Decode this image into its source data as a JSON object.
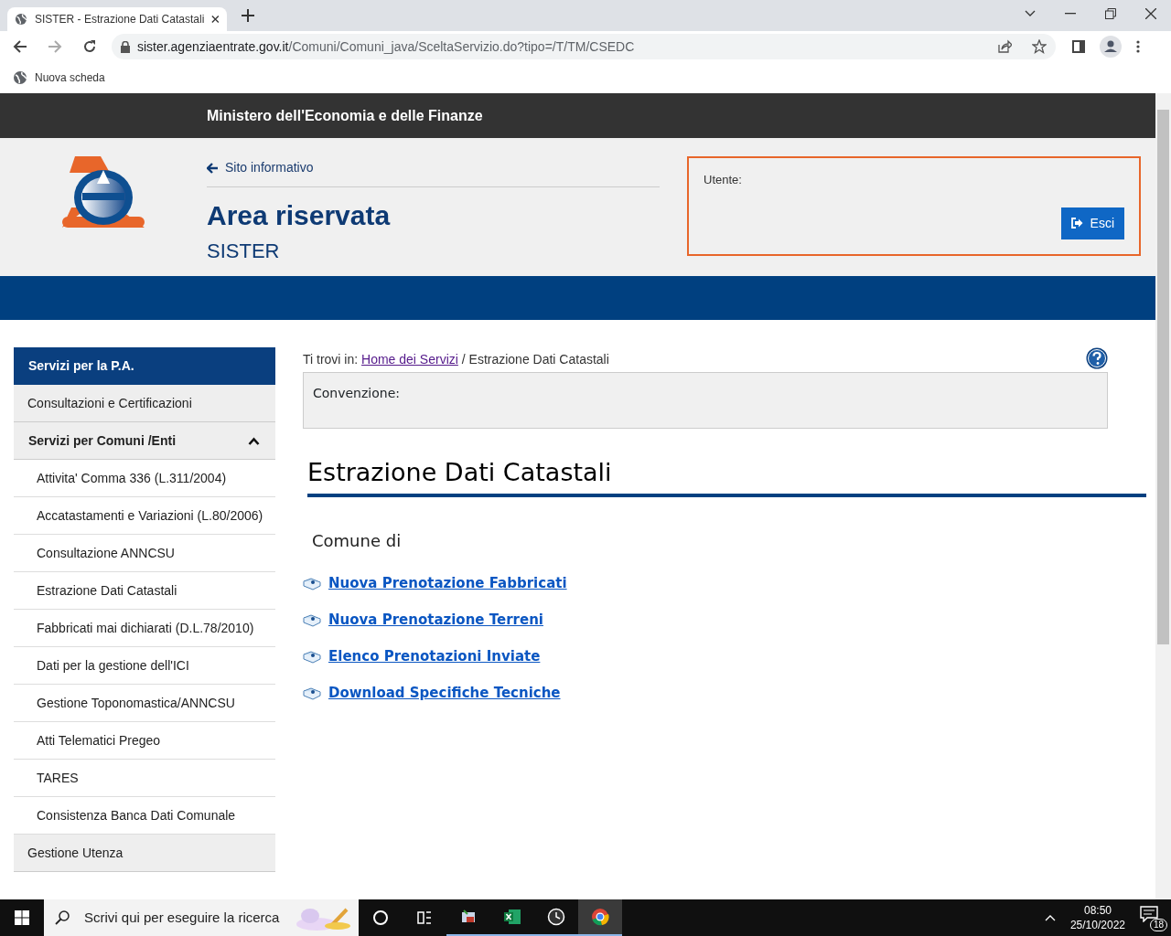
{
  "browser": {
    "tab_title": "SISTER - Estrazione Dati Catastali",
    "url_host": "sister.agenziaentrate.gov.it",
    "url_path": "/Comuni/Comuni_java/SceltaServizio.do?tipo=/T/TM/CSEDC",
    "bookmark": "Nuova scheda"
  },
  "header": {
    "ministry": "Ministero dell'Economia e delle Finanze",
    "back_link": "Sito informativo",
    "title": "Area riservata",
    "subtitle": "SISTER",
    "user_label": "Utente:",
    "logout": "Esci"
  },
  "sidebar": {
    "title": "Servizi per la P.A.",
    "items": [
      {
        "label": "Consultazioni e Certificazioni"
      },
      {
        "label": "Servizi per Comuni /Enti",
        "expanded": true,
        "children": [
          {
            "label": "Attivita' Comma 336 (L.311/2004)"
          },
          {
            "label": "Accatastamenti e Variazioni (L.80/2006)"
          },
          {
            "label": "Consultazione ANNCSU"
          },
          {
            "label": "Estrazione Dati Catastali"
          },
          {
            "label": "Fabbricati mai dichiarati (D.L.78/2010)"
          },
          {
            "label": "Dati per la gestione dell'ICI"
          },
          {
            "label": "Gestione Toponomastica/ANNCSU"
          },
          {
            "label": "Atti Telematici Pregeo"
          },
          {
            "label": "TARES"
          },
          {
            "label": "Consistenza Banca Dati Comunale"
          }
        ]
      },
      {
        "label": "Gestione Utenza"
      }
    ]
  },
  "breadcrumb": {
    "label": "Ti trovi in:",
    "link": "Home dei Servizi",
    "separator": "/",
    "current": "Estrazione Dati Catastali"
  },
  "convention": {
    "label": "Convenzione:"
  },
  "page_title": "Estrazione Dati Catastali",
  "section_title": "Comune di",
  "links": [
    "Nuova Prenotazione Fabbricati",
    "Nuova Prenotazione Terreni",
    "Elenco Prenotazioni Inviate",
    "Download Specifiche Tecniche"
  ],
  "taskbar": {
    "search_placeholder": "Scrivi qui per eseguire la ricerca",
    "time": "08:50",
    "date": "25/10/2022",
    "notifications": "18"
  }
}
